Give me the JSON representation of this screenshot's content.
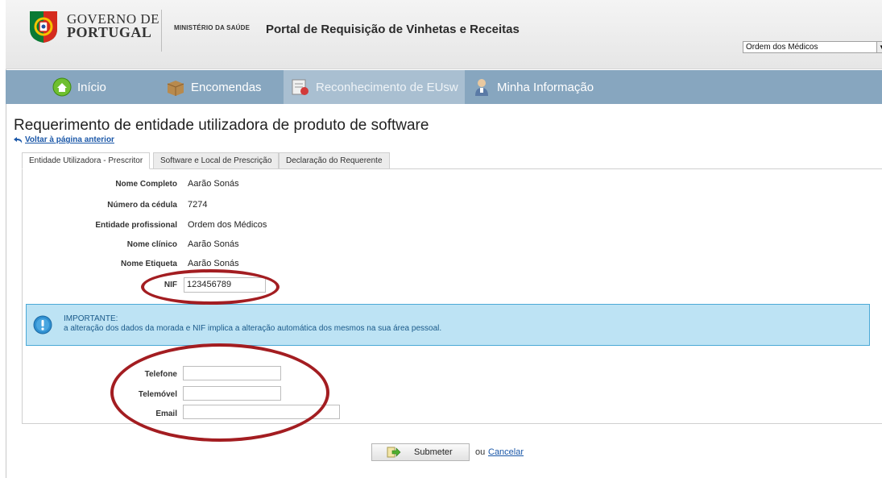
{
  "header": {
    "logo_line1": "GOVERNO DE",
    "logo_line2": "PORTUGAL",
    "ministry": "MINISTÉRIO DA SAÚDE",
    "portal_title": "Portal de Requisição de Vinhetas e Receitas",
    "org_select_value": "Ordem dos Médicos"
  },
  "nav": {
    "items": [
      {
        "label": "Início",
        "icon": "home-icon"
      },
      {
        "label": "Encomendas",
        "icon": "box-icon"
      },
      {
        "label": "Reconhecimento de EUsw",
        "icon": "certificate-icon"
      },
      {
        "label": "Minha Informação",
        "icon": "user-icon"
      }
    ]
  },
  "page": {
    "title": "Requerimento de entidade utilizadora de produto de software",
    "back_link": "Voltar à página anterior"
  },
  "tabs": [
    {
      "label": "Entidade Utilizadora - Prescritor",
      "active": true
    },
    {
      "label": "Software e Local de Prescrição",
      "active": false
    },
    {
      "label": "Declaração do Requerente",
      "active": false
    }
  ],
  "form": {
    "rows": [
      {
        "label": "Nome Completo",
        "value": "Aarão Sonás"
      },
      {
        "label": "Número da cédula",
        "value": "7274"
      },
      {
        "label": "Entidade profissional",
        "value": "Ordem dos Médicos"
      },
      {
        "label": "Nome clínico",
        "value": "Aarão Sonás"
      },
      {
        "label": "Nome Etiqueta",
        "value": "Aarão Sonás"
      }
    ],
    "nif_label": "NIF",
    "nif_value": "123456789",
    "alert_title": "IMPORTANTE:",
    "alert_text": "a alteração dos dados da morada e NIF implica a alteração automática dos mesmos na sua área pessoal.",
    "phone_label": "Telefone",
    "mobile_label": "Telemóvel",
    "email_label": "Email"
  },
  "actions": {
    "submit_label": "Submeter",
    "or_text": "ou",
    "cancel_label": "Cancelar"
  },
  "colors": {
    "nav_bg": "#87a6bf",
    "alert_bg": "#bde3f4",
    "highlight_ellipse": "#a31d21"
  }
}
